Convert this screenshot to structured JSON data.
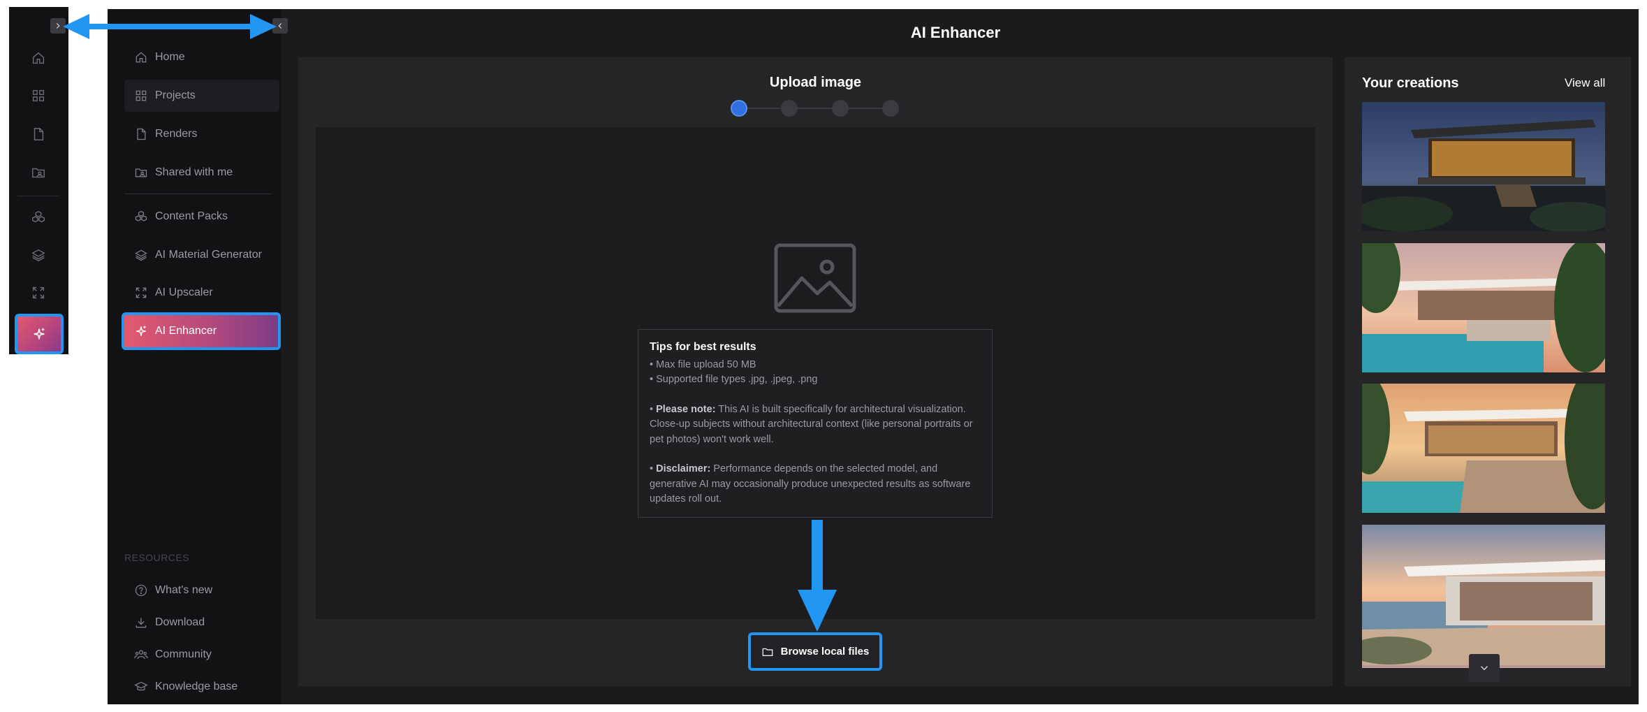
{
  "page": {
    "title": "AI Enhancer"
  },
  "rail": {
    "items": [
      {
        "icon": "home-icon"
      },
      {
        "icon": "grid-icon"
      },
      {
        "icon": "file-icon"
      },
      {
        "icon": "shared-folder-icon"
      },
      {
        "icon": "cubes-icon"
      },
      {
        "icon": "layers-icon"
      },
      {
        "icon": "expand-icon"
      },
      {
        "icon": "sparkle-icon",
        "active": true
      }
    ]
  },
  "sidebar": {
    "items": [
      {
        "label": "Home",
        "icon": "home-icon"
      },
      {
        "label": "Projects",
        "icon": "grid-icon"
      },
      {
        "label": "Renders",
        "icon": "file-icon"
      },
      {
        "label": "Shared with me",
        "icon": "shared-folder-icon"
      },
      {
        "label": "Content Packs",
        "icon": "cubes-icon"
      },
      {
        "label": "AI Material Generator",
        "icon": "layers-icon"
      },
      {
        "label": "AI Upscaler",
        "icon": "expand-icon"
      },
      {
        "label": "AI Enhancer",
        "icon": "sparkle-icon",
        "active": true
      }
    ],
    "resources_label": "RESOURCES",
    "resources": [
      {
        "label": "What's new",
        "icon": "question-icon"
      },
      {
        "label": "Download",
        "icon": "download-icon"
      },
      {
        "label": "Community",
        "icon": "community-icon"
      },
      {
        "label": "Knowledge base",
        "icon": "graduation-cap-icon"
      }
    ]
  },
  "upload": {
    "title": "Upload image",
    "steps_total": 4,
    "current_step": 1,
    "tips": {
      "title": "Tips for best results",
      "line1": "• Max file upload 50 MB",
      "line2": "• Supported file types .jpg, .jpeg, .png",
      "note_prefix": "• ",
      "note_label": "Please note:",
      "note_text": " This AI is built specifically for architectural visualization. Close-up subjects without architectural context (like personal portraits or pet photos) won't work well.",
      "disclaimer_prefix": "• ",
      "disclaimer_label": "Disclaimer:",
      "disclaimer_text": " Performance depends on the selected model, and generative AI may occasionally produce unexpected results as software updates roll out."
    },
    "browse_label": "Browse local files"
  },
  "creations": {
    "title": "Your creations",
    "view_all": "View all"
  },
  "colors": {
    "accent_gradient_start": "#e4596e",
    "accent_gradient_end": "#7c3c86",
    "annotation_blue": "#2196f3",
    "step_active": "#2f6fe0"
  }
}
